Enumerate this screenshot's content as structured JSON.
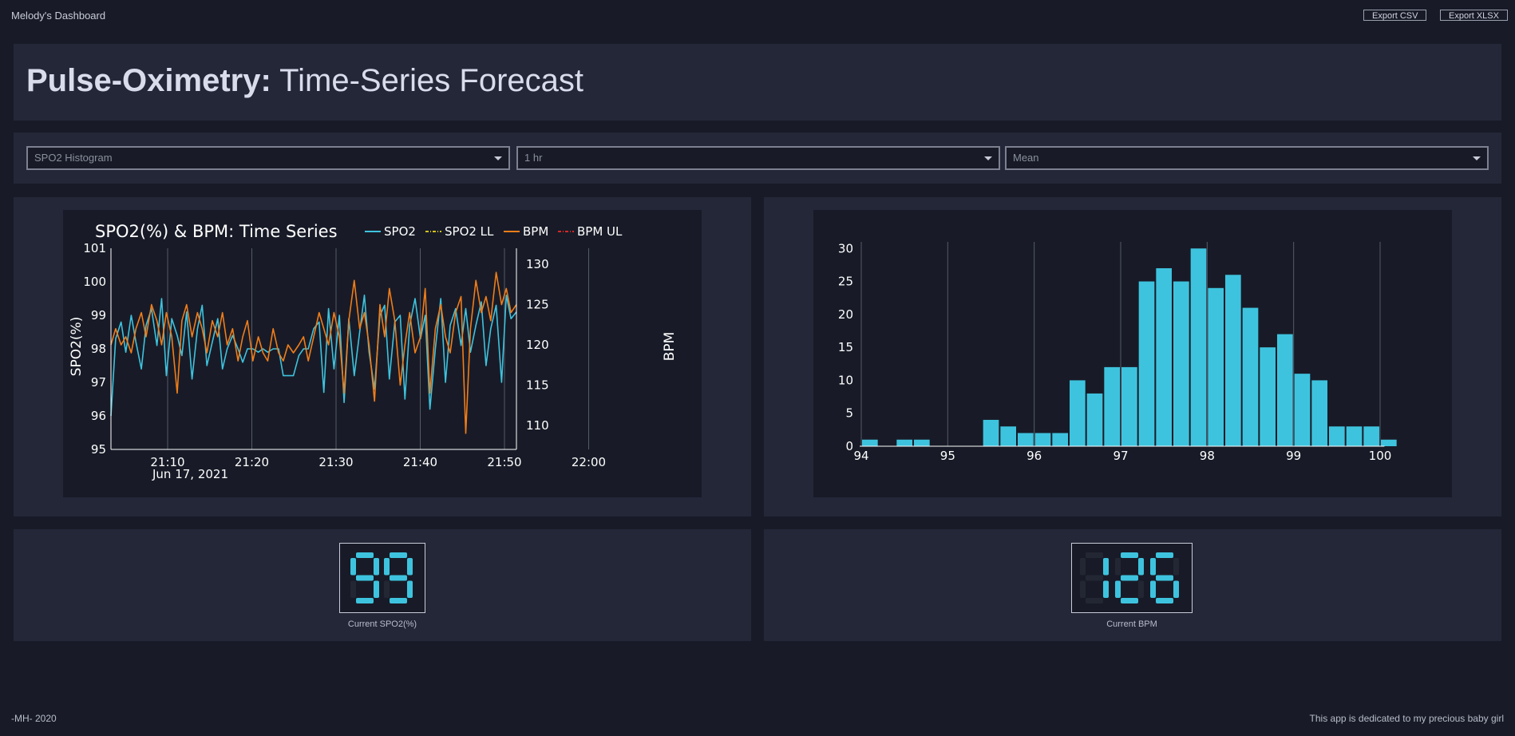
{
  "app": {
    "title": "Melody's Dashboard",
    "export_csv": "Export CSV",
    "export_xlsx": "Export XLSX"
  },
  "header": {
    "title_bold": "Pulse-Oximetry:",
    "title_rest": " Time-Series Forecast"
  },
  "controls": {
    "chart_select": "SPO2 Histogram",
    "window_select": "1 hr",
    "agg_select": "Mean"
  },
  "gauges": {
    "spo2_value": "99",
    "spo2_label": "Current SPO2(%)",
    "bpm_value": "126",
    "bpm_label": "Current BPM"
  },
  "footer": {
    "left": "-MH- 2020",
    "right": "This app is dedicated to my precious baby girl"
  },
  "colors": {
    "spo2": "#3ec3de",
    "bpm": "#f07d1a",
    "spo2_ll": "#d4c21a",
    "bpm_ul": "#d62728",
    "bar": "#3ec3de"
  },
  "chart_data": [
    {
      "type": "line",
      "title": "SPO2(%) & BPM: Time Series",
      "ylabel": "SPO2(%)",
      "y2label": "BPM",
      "ylim": [
        95,
        101
      ],
      "y2lim": [
        107,
        132
      ],
      "yticks": [
        "95",
        "96",
        "97",
        "98",
        "99",
        "100",
        "101"
      ],
      "y2ticks": [
        "110",
        "115",
        "120",
        "125",
        "130"
      ],
      "xticks": [
        "21:10",
        "21:20",
        "21:30",
        "21:40",
        "21:50",
        "22:00"
      ],
      "xdate": "Jun 17, 2021",
      "legend": [
        "SPO2",
        "SPO2 LL",
        "BPM",
        "BPM UL"
      ],
      "legend_position": "top-right",
      "series": [
        {
          "name": "SPO2",
          "axis": "left",
          "x_minutes": [
            0.0,
            0.7,
            1.5,
            2.2,
            3.0,
            3.7,
            4.5,
            5.2,
            6.0,
            6.8,
            7.5,
            8.2,
            9.0,
            9.8,
            10.5,
            11.2,
            12.0,
            12.8,
            13.5,
            14.2,
            15.0,
            15.8,
            16.5,
            17.2,
            18.0,
            18.8,
            19.5,
            20.2,
            21.0,
            21.8,
            22.5,
            23.2,
            24.0,
            24.8,
            25.5,
            26.2,
            27.0,
            27.8,
            28.5,
            29.2,
            30.0,
            30.8,
            31.5,
            32.2,
            33.0,
            33.8,
            34.5,
            35.2,
            36.0,
            36.8,
            37.5,
            38.2,
            39.0,
            39.8,
            40.5,
            41.2,
            42.0,
            42.8,
            43.5,
            44.2,
            45.0,
            45.8,
            46.5,
            47.2,
            48.0,
            48.8,
            49.5,
            50.2,
            51.0,
            51.8,
            52.5,
            53.2,
            54.0,
            54.8,
            55.5,
            56.2,
            57.0,
            57.8,
            58.5,
            59.2,
            60.0
          ],
          "values": [
            96.0,
            98.3,
            98.8,
            97.9,
            99.0,
            98.2,
            97.4,
            98.7,
            99.2,
            98.1,
            99.5,
            97.2,
            98.9,
            98.4,
            97.8,
            99.1,
            97.1,
            98.6,
            99.3,
            97.5,
            98.2,
            98.9,
            97.4,
            98.0,
            98.4,
            98.0,
            97.6,
            98.0,
            98.0,
            97.9,
            98.0,
            97.9,
            98.0,
            98.0,
            97.2,
            97.2,
            97.2,
            97.8,
            98.0,
            98.0,
            98.6,
            98.8,
            96.7,
            99.2,
            97.4,
            99.0,
            96.4,
            98.9,
            97.2,
            98.5,
            99.6,
            97.9,
            96.8,
            99.0,
            99.3,
            97.1,
            98.8,
            99.0,
            96.5,
            98.7,
            99.5,
            98.3,
            99.0,
            96.2,
            98.0,
            99.5,
            97.0,
            98.7,
            99.2,
            98.1,
            99.2,
            97.9,
            98.7,
            99.4,
            97.5,
            98.6,
            99.3,
            97.0,
            99.6,
            98.9,
            99.1
          ]
        },
        {
          "name": "BPM",
          "axis": "right",
          "x_minutes": [
            0.0,
            0.7,
            1.5,
            2.2,
            3.0,
            3.7,
            4.5,
            5.2,
            6.0,
            6.8,
            7.5,
            8.2,
            9.0,
            9.8,
            10.5,
            11.2,
            12.0,
            12.8,
            13.5,
            14.2,
            15.0,
            15.8,
            16.5,
            17.2,
            18.0,
            18.8,
            19.5,
            20.2,
            21.0,
            21.8,
            22.5,
            23.2,
            24.0,
            24.8,
            25.5,
            26.2,
            27.0,
            27.8,
            28.5,
            29.2,
            30.0,
            30.8,
            31.5,
            32.2,
            33.0,
            33.8,
            34.5,
            35.2,
            36.0,
            36.8,
            37.5,
            38.2,
            39.0,
            39.8,
            40.5,
            41.2,
            42.0,
            42.8,
            43.5,
            44.2,
            45.0,
            45.8,
            46.5,
            47.2,
            48.0,
            48.8,
            49.5,
            50.2,
            51.0,
            51.8,
            52.5,
            53.2,
            54.0,
            54.8,
            55.5,
            56.2,
            57.0,
            57.8,
            58.5,
            59.2,
            60.0
          ],
          "values": [
            120,
            122,
            120,
            121,
            119,
            122,
            124,
            121,
            125,
            123,
            120,
            124,
            121,
            114,
            123,
            125,
            121,
            124,
            122,
            119,
            123,
            121,
            124,
            120,
            122,
            118,
            121,
            123,
            118,
            121,
            119,
            118,
            122,
            119,
            118,
            120,
            119,
            120,
            121,
            118,
            121,
            124,
            122,
            120,
            124,
            121,
            114,
            123,
            128,
            122,
            124,
            120,
            113,
            125,
            121,
            127,
            123,
            115,
            120,
            124,
            119,
            121,
            127,
            114,
            122,
            125,
            121,
            119,
            124,
            126,
            109,
            122,
            128,
            124,
            126,
            123,
            129,
            125,
            127,
            124,
            125
          ]
        }
      ]
    },
    {
      "type": "bar",
      "xlim": [
        94,
        100
      ],
      "ylim": [
        0,
        31
      ],
      "xticks": [
        "94",
        "95",
        "96",
        "97",
        "98",
        "99",
        "100"
      ],
      "yticks": [
        "0",
        "5",
        "10",
        "15",
        "20",
        "25",
        "30"
      ],
      "bin_start": 94.0,
      "bin_width": 0.2,
      "values": [
        1,
        0,
        1,
        1,
        0,
        0,
        0,
        4,
        3,
        2,
        2,
        2,
        10,
        8,
        12,
        12,
        25,
        27,
        25,
        30,
        24,
        26,
        21,
        15,
        17,
        11,
        10,
        3,
        3,
        3,
        1
      ]
    }
  ]
}
